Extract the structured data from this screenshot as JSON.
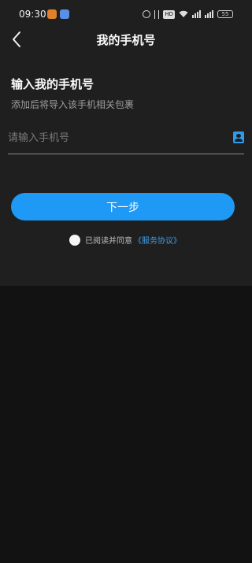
{
  "status_bar": {
    "time": "09:30",
    "hd_label": "HD",
    "battery_label": "55"
  },
  "header": {
    "title": "我的手机号"
  },
  "form": {
    "heading": "输入我的手机号",
    "subheading": "添加后将导入该手机相关包裹",
    "phone_placeholder": "请输入手机号",
    "next_label": "下一步"
  },
  "agreement": {
    "text": "已阅读并同意",
    "link": "《服务协议》"
  },
  "colors": {
    "accent": "#1e99f5",
    "link": "#3d9eea",
    "panel": "#1f1f1f",
    "background": "#121212"
  },
  "icons": {
    "back": "back-arrow-icon",
    "contacts": "contacts-icon",
    "radio": "radio-unchecked-icon"
  }
}
